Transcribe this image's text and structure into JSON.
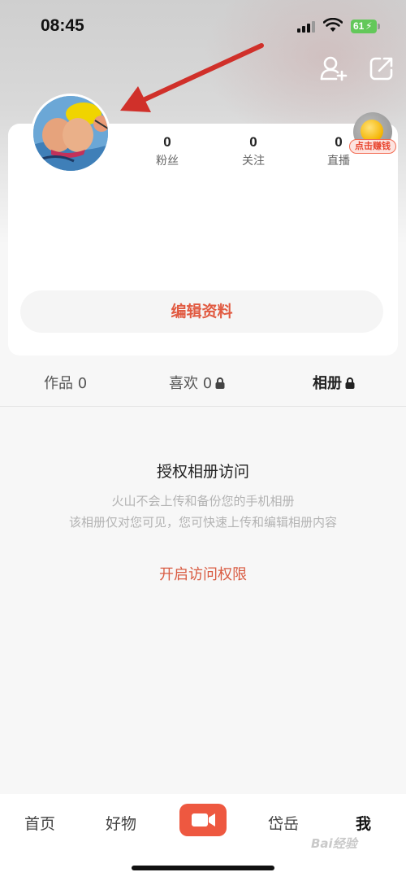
{
  "status_bar": {
    "time": "08:45",
    "battery": "61"
  },
  "header": {
    "add_friend_icon": "add-user-icon",
    "share_icon": "share-icon"
  },
  "profile": {
    "stats": [
      {
        "value": "0",
        "label": "粉丝"
      },
      {
        "value": "0",
        "label": "关注"
      },
      {
        "value": "0",
        "label": "直播"
      }
    ],
    "coin_badge": "点击赚钱",
    "edit_button": "编辑资料"
  },
  "tabs": [
    {
      "label": "作品 0",
      "locked": false
    },
    {
      "label": "喜欢 0",
      "locked": true
    },
    {
      "label": "相册",
      "locked": true,
      "selected": true
    }
  ],
  "album": {
    "title": "授权相册访问",
    "desc_line1": "火山不会上传和备份您的手机相册",
    "desc_line2": "该相册仅对您可见，您可快速上传和编辑相册内容",
    "action": "开启访问权限"
  },
  "bottom_nav": {
    "items": [
      "首页",
      "好物",
      "岱岳",
      "我"
    ],
    "selected": "我"
  },
  "watermark": "Bai经验",
  "colors": {
    "accent": "#e15b42",
    "camera": "#ee5840",
    "arrow": "#d0302a"
  }
}
